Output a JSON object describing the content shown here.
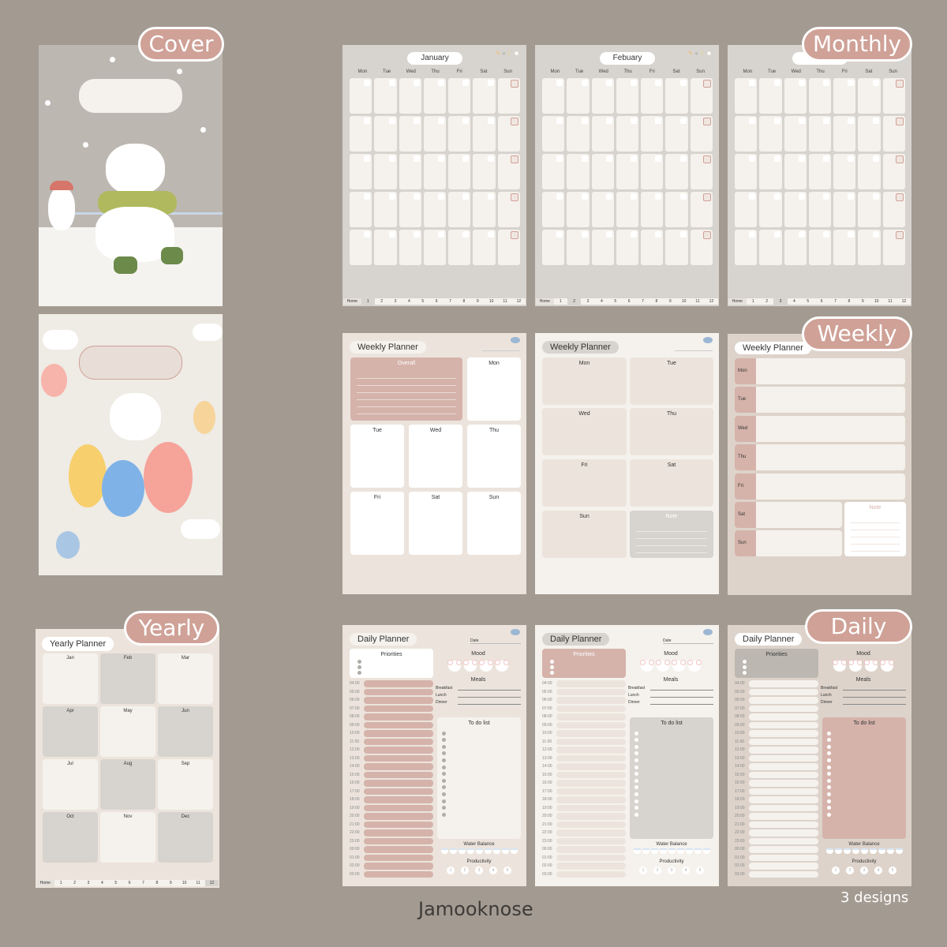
{
  "tags": {
    "cover": "Cover",
    "monthly": "Monthly",
    "weekly": "Weekly",
    "yearly": "Yearly",
    "daily": "Daily"
  },
  "brand": "Jamooknose",
  "designs_note": "3 designs",
  "day_labels": [
    "Mon",
    "Tue",
    "Wed",
    "Thu",
    "Fri",
    "Sat",
    "Sun"
  ],
  "nav": {
    "home": "Home",
    "months": [
      "1",
      "2",
      "3",
      "4",
      "5",
      "6",
      "7",
      "8",
      "9",
      "10",
      "11",
      "12"
    ]
  },
  "monthly": {
    "pages": [
      {
        "title": "January",
        "active_tab": 1
      },
      {
        "title": "Febuary",
        "active_tab": 2
      },
      {
        "title": "",
        "active_tab": 3
      }
    ],
    "tool_icons": [
      "pencil-icon",
      "coin-icon",
      "moon-icon",
      "note-icon"
    ]
  },
  "weekly": {
    "title": "Weekly Planner",
    "overall": "Overall",
    "note": "Note",
    "days": [
      "Mon",
      "Tue",
      "Wed",
      "Thu",
      "Fri",
      "Sat",
      "Sun"
    ]
  },
  "daily": {
    "title": "Daily Planner",
    "date_label": "Date",
    "priorities": "Priorities",
    "mood": "Mood",
    "meals": "Meals",
    "meal_items": [
      "Breakfast",
      "Lunch",
      "Dinner"
    ],
    "todo": "To do list",
    "water": "Water Balance",
    "productivity": "Productivity",
    "productivity_scale": [
      "1",
      "2",
      "3",
      "4",
      "5"
    ],
    "hours": [
      "04:00",
      "05:00",
      "06:00",
      "07:00",
      "08:00",
      "09:00",
      "10:00",
      "11:00",
      "12:00",
      "13:00",
      "14:00",
      "15:00",
      "16:00",
      "17:00",
      "18:00",
      "19:00",
      "20:00",
      "21:00",
      "22:00",
      "23:00",
      "00:00",
      "01:00",
      "02:00",
      "03:00"
    ]
  },
  "yearly": {
    "title": "Yearly Planner",
    "months": [
      "Jan",
      "Feb",
      "Mar",
      "Apr",
      "May",
      "Jun",
      "Jul",
      "Aug",
      "Sep",
      "Oct",
      "Nov",
      "Dec"
    ],
    "active_tab": 12
  }
}
